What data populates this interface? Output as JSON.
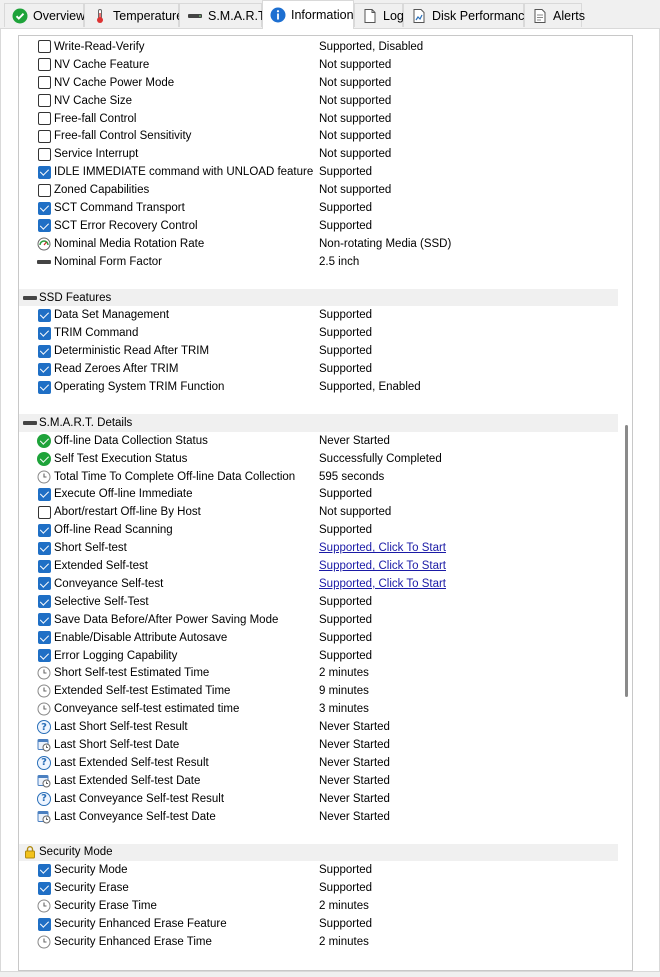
{
  "tabs": [
    {
      "label": "Overview",
      "icon": "green-check-icon"
    },
    {
      "label": "Temperature",
      "icon": "thermometer-icon"
    },
    {
      "label": "S.M.A.R.T.",
      "icon": "drive-icon"
    },
    {
      "label": "Information",
      "icon": "info-icon",
      "active": true
    },
    {
      "label": "Log",
      "icon": "document-icon"
    },
    {
      "label": "Disk Performance",
      "icon": "disk-performance-icon"
    },
    {
      "label": "Alerts",
      "icon": "alerts-icon"
    }
  ],
  "rows": [
    {
      "icon": "checkbox-off",
      "name": "Write-Read-Verify",
      "value": "Supported, Disabled"
    },
    {
      "icon": "checkbox-off",
      "name": "NV Cache Feature",
      "value": "Not supported"
    },
    {
      "icon": "checkbox-off",
      "name": "NV Cache Power Mode",
      "value": "Not supported"
    },
    {
      "icon": "checkbox-off",
      "name": "NV Cache Size",
      "value": "Not supported"
    },
    {
      "icon": "checkbox-off",
      "name": "Free-fall Control",
      "value": "Not supported"
    },
    {
      "icon": "checkbox-off",
      "name": "Free-fall Control Sensitivity",
      "value": "Not supported"
    },
    {
      "icon": "checkbox-off",
      "name": "Service Interrupt",
      "value": "Not supported"
    },
    {
      "icon": "checkbox-on",
      "name": "IDLE IMMEDIATE command with UNLOAD feature",
      "value": "Supported"
    },
    {
      "icon": "checkbox-off",
      "name": "Zoned Capabilities",
      "value": "Not supported"
    },
    {
      "icon": "checkbox-on",
      "name": "SCT Command Transport",
      "value": "Supported"
    },
    {
      "icon": "checkbox-on",
      "name": "SCT Error Recovery Control",
      "value": "Supported"
    },
    {
      "icon": "rotation-gauge",
      "name": "Nominal Media Rotation Rate",
      "value": "Non-rotating Media (SSD)"
    },
    {
      "icon": "drive-bar",
      "name": "Nominal Form Factor",
      "value": "2.5 inch"
    },
    {
      "icon": "blank",
      "name": "",
      "value": ""
    },
    {
      "icon": "drive-bar",
      "name": "SSD Features",
      "value": "",
      "header": true
    },
    {
      "icon": "checkbox-on",
      "name": "Data Set Management",
      "value": "Supported"
    },
    {
      "icon": "checkbox-on",
      "name": "TRIM Command",
      "value": "Supported"
    },
    {
      "icon": "checkbox-on",
      "name": "Deterministic Read After TRIM",
      "value": "Supported"
    },
    {
      "icon": "checkbox-on",
      "name": "Read Zeroes After TRIM",
      "value": "Supported"
    },
    {
      "icon": "checkbox-on",
      "name": "Operating System TRIM Function",
      "value": "Supported, Enabled"
    },
    {
      "icon": "blank",
      "name": "",
      "value": ""
    },
    {
      "icon": "drive-bar",
      "name": "S.M.A.R.T. Details",
      "value": "",
      "header": true
    },
    {
      "icon": "green-check",
      "name": "Off-line Data Collection Status",
      "value": "Never Started"
    },
    {
      "icon": "green-check",
      "name": "Self Test Execution Status",
      "value": "Successfully Completed"
    },
    {
      "icon": "clock",
      "name": "Total Time To Complete Off-line Data Collection",
      "value": "595 seconds"
    },
    {
      "icon": "checkbox-on",
      "name": "Execute Off-line Immediate",
      "value": "Supported"
    },
    {
      "icon": "checkbox-off",
      "name": "Abort/restart Off-line By Host",
      "value": "Not supported"
    },
    {
      "icon": "checkbox-on",
      "name": "Off-line Read Scanning",
      "value": "Supported"
    },
    {
      "icon": "checkbox-on",
      "name": "Short Self-test",
      "value": "Supported, Click To Start",
      "link": true
    },
    {
      "icon": "checkbox-on",
      "name": "Extended Self-test",
      "value": "Supported, Click To Start",
      "link": true
    },
    {
      "icon": "checkbox-on",
      "name": "Conveyance Self-test",
      "value": "Supported, Click To Start",
      "link": true
    },
    {
      "icon": "checkbox-on",
      "name": "Selective Self-Test",
      "value": "Supported"
    },
    {
      "icon": "checkbox-on",
      "name": "Save Data Before/After Power Saving Mode",
      "value": "Supported"
    },
    {
      "icon": "checkbox-on",
      "name": "Enable/Disable Attribute Autosave",
      "value": "Supported"
    },
    {
      "icon": "checkbox-on",
      "name": "Error Logging Capability",
      "value": "Supported"
    },
    {
      "icon": "clock",
      "name": "Short Self-test Estimated Time",
      "value": "2 minutes"
    },
    {
      "icon": "clock",
      "name": "Extended Self-test Estimated Time",
      "value": "9 minutes"
    },
    {
      "icon": "clock",
      "name": "Conveyance self-test estimated time",
      "value": "3 minutes"
    },
    {
      "icon": "question",
      "name": "Last Short Self-test Result",
      "value": "Never Started"
    },
    {
      "icon": "calendar-clock",
      "name": "Last Short Self-test Date",
      "value": "Never Started"
    },
    {
      "icon": "question",
      "name": "Last Extended Self-test Result",
      "value": "Never Started"
    },
    {
      "icon": "calendar-clock",
      "name": "Last Extended Self-test Date",
      "value": "Never Started"
    },
    {
      "icon": "question",
      "name": "Last Conveyance Self-test Result",
      "value": "Never Started"
    },
    {
      "icon": "calendar-clock",
      "name": "Last Conveyance Self-test Date",
      "value": "Never Started"
    },
    {
      "icon": "blank",
      "name": "",
      "value": ""
    },
    {
      "icon": "padlock",
      "name": "Security Mode",
      "value": "",
      "header": true
    },
    {
      "icon": "checkbox-on",
      "name": "Security Mode",
      "value": "Supported"
    },
    {
      "icon": "checkbox-on",
      "name": "Security Erase",
      "value": "Supported"
    },
    {
      "icon": "clock",
      "name": "Security Erase Time",
      "value": "2 minutes"
    },
    {
      "icon": "checkbox-on",
      "name": "Security Enhanced Erase Feature",
      "value": "Supported"
    },
    {
      "icon": "clock",
      "name": "Security Enhanced Erase Time",
      "value": "2 minutes"
    }
  ],
  "colors": {
    "checkbox_on": "#1f6fc5",
    "link": "#1a1aa6",
    "status_ok": "#1ea33a",
    "header_bg": "#f0f0f0"
  }
}
